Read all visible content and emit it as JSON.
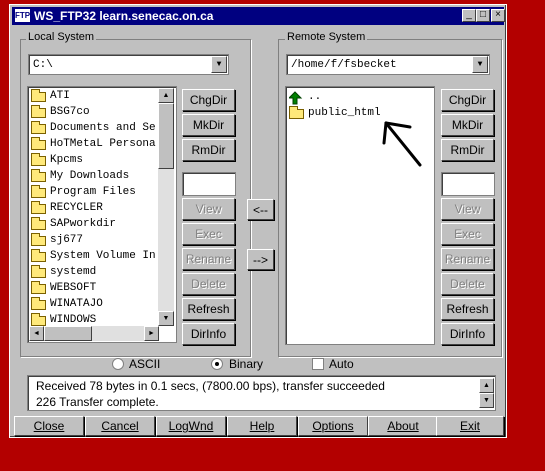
{
  "window": {
    "app_icon": "FTP",
    "title": "WS_FTP32 learn.senecac.on.ca",
    "minimize": "_",
    "maximize": "□",
    "close": "×"
  },
  "local": {
    "group_title": "Local System",
    "path": "C:\\",
    "items": [
      "ATI",
      "BSG7co",
      "Documents and Se",
      "HoTMetaL Persona",
      "Kpcms",
      "My Downloads",
      "Program Files",
      "RECYCLER",
      "SAPworkdir",
      "sj677",
      "System Volume In",
      "systemd",
      "WEBSOFT",
      "WINATAJO",
      "WINDOWS"
    ],
    "buttons": {
      "chgdir": "ChgDir",
      "mkdir": "MkDir",
      "rmdir": "RmDir",
      "view": "View",
      "exec": "Exec",
      "rename": "Rename",
      "delete": "Delete",
      "refresh": "Refresh",
      "dirinfo": "DirInfo"
    }
  },
  "remote": {
    "group_title": "Remote System",
    "path": "/home/f/fsbecket",
    "items": [
      "..",
      "public_html"
    ],
    "buttons": {
      "chgdir": "ChgDir",
      "mkdir": "MkDir",
      "rmdir": "RmDir",
      "view": "View",
      "exec": "Exec",
      "rename": "Rename",
      "delete": "Delete",
      "refresh": "Refresh",
      "dirinfo": "DirInfo"
    }
  },
  "transfer": {
    "to_local": "<--",
    "to_remote": "-->"
  },
  "mode": {
    "ascii": "ASCII",
    "binary": "Binary",
    "auto": "Auto",
    "selected": "binary"
  },
  "status": {
    "line1": "Received 78 bytes in 0.1 secs, (7800.00 bps), transfer succeeded",
    "line2": "226 Transfer complete."
  },
  "bottom": {
    "close": "Close",
    "cancel": "Cancel",
    "logwnd": "LogWnd",
    "help": "Help",
    "options": "Options",
    "about": "About",
    "exit": "Exit"
  },
  "scroll_arrows": {
    "up": "▲",
    "down": "▼",
    "left": "◄",
    "right": "►",
    "combo": "▼"
  },
  "colors": {
    "desktop": "#b30000",
    "titlebar": "#000080",
    "face": "#c0c0c0"
  }
}
